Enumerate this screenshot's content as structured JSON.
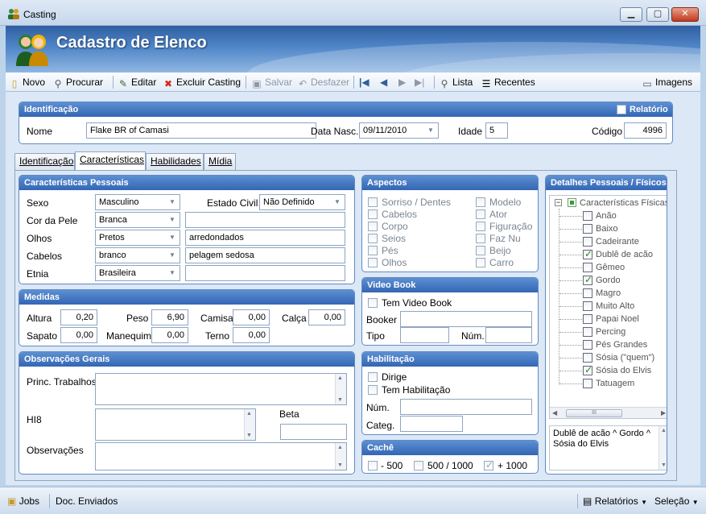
{
  "window": {
    "title": "Casting",
    "min": "▁",
    "max": "▢",
    "close": "✕"
  },
  "banner": {
    "title": "Cadastro de Elenco"
  },
  "toolbar": {
    "novo": "Novo",
    "procurar": "Procurar",
    "editar": "Editar",
    "excluir": "Excluir Casting",
    "salvar": "Salvar",
    "desfazer": "Desfazer",
    "lista": "Lista",
    "recentes": "Recentes",
    "imagens": "Imagens"
  },
  "identificacao": {
    "header": "Identificação",
    "relatorio": "Relatório",
    "nome_label": "Nome",
    "nome_value": "Flake BR of Camasi",
    "data_label": "Data Nasc.",
    "data_value": "09/11/2010",
    "idade_label": "Idade",
    "idade_value": "5",
    "codigo_label": "Código",
    "codigo_value": "4996"
  },
  "tabs": [
    "Identificação",
    "Características",
    "Habilidades",
    "Mídia"
  ],
  "pessoais": {
    "header": "Características Pessoais",
    "sexo_label": "Sexo",
    "sexo_value": "Masculino",
    "estado_label": "Estado Civil",
    "estado_value": "Não Definido",
    "pele_label": "Cor da Pele",
    "pele_value": "Branca",
    "pele_extra": "",
    "olhos_label": "Olhos",
    "olhos_value": "Pretos",
    "olhos_extra": "arredondados",
    "cabelos_label": "Cabelos",
    "cabelos_value": "branco",
    "cabelos_extra": "pelagem sedosa",
    "etnia_label": "Etnia",
    "etnia_value": "Brasileira",
    "etnia_extra": ""
  },
  "medidas": {
    "header": "Medidas",
    "altura_label": "Altura",
    "altura": "0,20",
    "peso_label": "Peso",
    "peso": "6,90",
    "camisa_label": "Camisa",
    "camisa": "0,00",
    "calca_label": "Calça",
    "calca": "0,00",
    "sapato_label": "Sapato",
    "sapato": "0,00",
    "manequim_label": "Manequim",
    "manequim": "0,00",
    "terno_label": "Terno",
    "terno": "0,00"
  },
  "obs": {
    "header": "Observações Gerais",
    "princ_label": "Princ. Trabalhos",
    "hi8_label": "HI8",
    "beta_label": "Beta",
    "obs_label": "Observações"
  },
  "aspectos": {
    "header": "Aspectos",
    "left": [
      "Sorriso / Dentes",
      "Cabelos",
      "Corpo",
      "Seios",
      "Pés",
      "Olhos"
    ],
    "right": [
      "Modelo",
      "Ator",
      "Figuração",
      "Faz Nu",
      "Beijo",
      "Carro"
    ]
  },
  "videobook": {
    "header": "Video Book",
    "tem": "Tem Video Book",
    "booker_label": "Booker",
    "tipo_label": "Tipo",
    "num_label": "Núm."
  },
  "habilitacao": {
    "header": "Habilitação",
    "dirige": "Dirige",
    "tem": "Tem Habilitação",
    "num_label": "Núm.",
    "categ_label": "Categ."
  },
  "cache": {
    "header": "Cachê",
    "opt1": "- 500",
    "opt2": "500 / 1000",
    "opt3": "+ 1000"
  },
  "detalhes": {
    "header": "Detalhes Pessoais / Físicos",
    "root": "Características Físicas",
    "items": [
      {
        "label": "Anão",
        "checked": false
      },
      {
        "label": "Baixo",
        "checked": false
      },
      {
        "label": "Cadeirante",
        "checked": false
      },
      {
        "label": "Dublê de acão",
        "checked": true
      },
      {
        "label": "Gêmeo",
        "checked": false
      },
      {
        "label": "Gordo",
        "checked": true
      },
      {
        "label": "Magro",
        "checked": false
      },
      {
        "label": "Muito Alto",
        "checked": false
      },
      {
        "label": "Papai Noel",
        "checked": false
      },
      {
        "label": "Percing",
        "checked": false
      },
      {
        "label": "Pés Grandes",
        "checked": false
      },
      {
        "label": "Sósia (\"quem\")",
        "checked": false
      },
      {
        "label": "Sósia do Elvis",
        "checked": true
      },
      {
        "label": "Tatuagem",
        "checked": false
      }
    ],
    "summary": "Dublê de acão ^ Gordo ^ Sósia do Elvis"
  },
  "status": {
    "jobs": "Jobs",
    "docs": "Doc. Enviados",
    "relatorios": "Relatórios",
    "selecao": "Seleção"
  },
  "colors": {
    "header_blue": "#3366b4",
    "banner_blue": "#2f5ea0",
    "accent": "#1f8b1f"
  }
}
